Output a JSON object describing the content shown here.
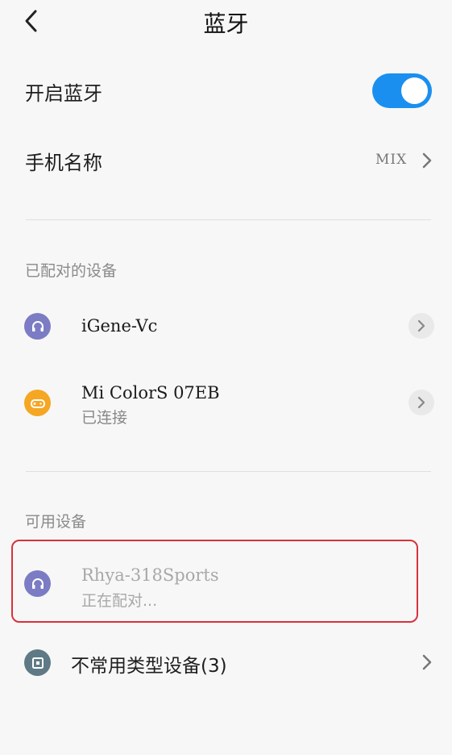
{
  "header": {
    "title": "蓝牙"
  },
  "settings": {
    "bluetooth_toggle_label": "开启蓝牙",
    "bluetooth_enabled": true,
    "phone_name_label": "手机名称",
    "phone_name_value": "MIX"
  },
  "paired": {
    "section_title": "已配对的设备",
    "devices": [
      {
        "name": "iGene-Vc",
        "status": "",
        "icon": "headset-icon",
        "icon_color": "#7b7cc4"
      },
      {
        "name": "Mi ColorS 07EB",
        "status": "已连接",
        "icon": "gamepad-icon",
        "icon_color": "#f5a623"
      }
    ]
  },
  "available": {
    "section_title": "可用设备",
    "devices": [
      {
        "name": "Rhya-318Sports",
        "status": "正在配对...",
        "icon": "headset-icon",
        "icon_color": "#7b7cc4"
      }
    ]
  },
  "uncommon": {
    "label": "不常用类型设备(3)",
    "icon": "device-box-icon",
    "icon_color": "#5f7a86"
  },
  "colors": {
    "accent": "#1a8ff0",
    "highlight": "#d8313d"
  }
}
